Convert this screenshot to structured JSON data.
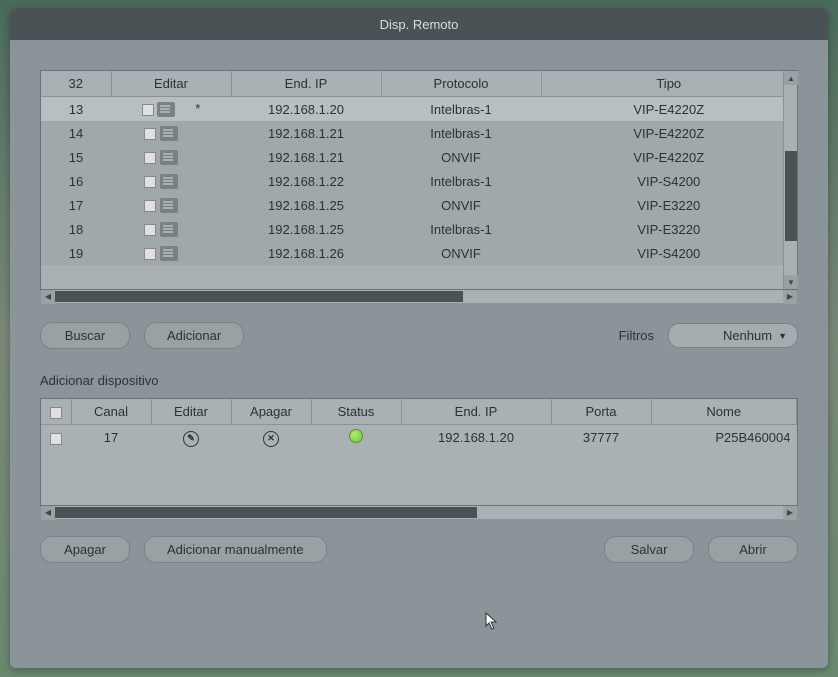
{
  "window": {
    "title": "Disp. Remoto"
  },
  "table1": {
    "headers": {
      "count": "32",
      "editar": "Editar",
      "end_ip": "End. IP",
      "protocolo": "Protocolo",
      "tipo": "Tipo"
    },
    "rows": [
      {
        "num": "13",
        "star": "*",
        "ip": "192.168.1.20",
        "protocol": "Intelbras-1",
        "type": "VIP-E4220Z",
        "selected": true
      },
      {
        "num": "14",
        "star": "",
        "ip": "192.168.1.21",
        "protocol": "Intelbras-1",
        "type": "VIP-E4220Z",
        "selected": false
      },
      {
        "num": "15",
        "star": "",
        "ip": "192.168.1.21",
        "protocol": "ONVIF",
        "type": "VIP-E4220Z",
        "selected": false
      },
      {
        "num": "16",
        "star": "",
        "ip": "192.168.1.22",
        "protocol": "Intelbras-1",
        "type": "VIP-S4200",
        "selected": false
      },
      {
        "num": "17",
        "star": "",
        "ip": "192.168.1.25",
        "protocol": "ONVIF",
        "type": "VIP-E3220",
        "selected": false
      },
      {
        "num": "18",
        "star": "",
        "ip": "192.168.1.25",
        "protocol": "Intelbras-1",
        "type": "VIP-E3220",
        "selected": false
      },
      {
        "num": "19",
        "star": "",
        "ip": "192.168.1.26",
        "protocol": "ONVIF",
        "type": "VIP-S4200",
        "selected": false
      }
    ]
  },
  "buttons": {
    "buscar": "Buscar",
    "adicionar": "Adicionar",
    "apagar": "Apagar",
    "adicionar_manual": "Adicionar manualmente",
    "salvar": "Salvar",
    "abrir": "Abrir"
  },
  "filters": {
    "label": "Filtros",
    "selected": "Nenhum"
  },
  "section2": {
    "title": "Adicionar dispositivo",
    "headers": {
      "canal": "Canal",
      "editar": "Editar",
      "apagar": "Apagar",
      "status": "Status",
      "end_ip": "End. IP",
      "porta": "Porta",
      "nome": "Nome"
    },
    "rows": [
      {
        "canal": "17",
        "ip": "192.168.1.20",
        "porta": "37777",
        "nome": "P25B460004"
      }
    ]
  }
}
